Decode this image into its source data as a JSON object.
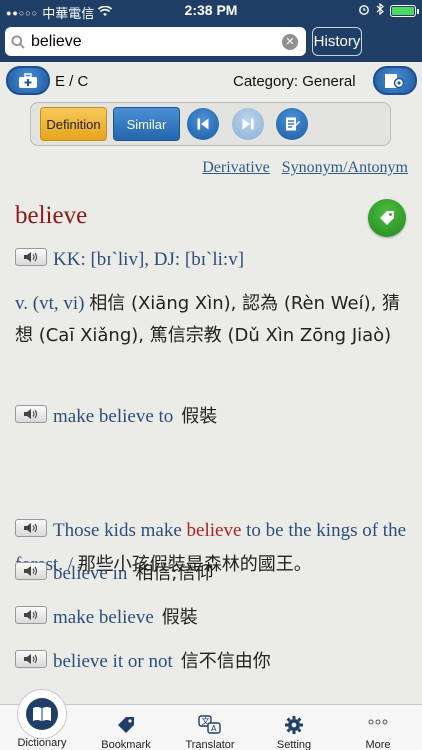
{
  "status": {
    "carrier": "中華電信",
    "time": "2:38 PM"
  },
  "search": {
    "value": "believe",
    "history_label": "History"
  },
  "header": {
    "mode": "E / C",
    "category": "Category: General"
  },
  "toolbar": {
    "definition_label": "Definition",
    "similar_label": "Similar"
  },
  "links": {
    "derivative": "Derivative",
    "synonym": "Synonym/Antonym"
  },
  "entry": {
    "headword": "believe",
    "pronunciation": "KK: [bɪˋliv], DJ: [bɪˋli:v]",
    "pos": "v. (vt, vi)",
    "definition_zh": "相信 (Xiāng Xìn), 認為 (Rèn Weí), 猜想 (Caī Xiǎng), 篤信宗教 (Dǔ Xìn Zōng Jiaò)",
    "phrases": [
      {
        "en": "make believe to",
        "zh": "假裝"
      },
      {
        "en": "believe in",
        "zh": "相信;信仰"
      },
      {
        "en": "make believe",
        "zh": "假裝"
      },
      {
        "en": "believe it or not",
        "zh": "信不信由你"
      }
    ],
    "example": {
      "before": "Those kids make ",
      "highlight": "believe",
      "after": " to be the kings of the forest. / ",
      "zh": "那些小孩假裝是森林的國王。"
    }
  },
  "tabs": {
    "dictionary": "Dictionary",
    "bookmark": "Bookmark",
    "translator": "Translator",
    "setting": "Setting",
    "more": "More"
  },
  "colors": {
    "navbar": "#1f3f66",
    "headword": "#8b1a1a",
    "body_text": "#2b4f7a",
    "accent_orange": "#e6a51f",
    "accent_blue": "#2566ad",
    "tag_green": "#1e8a1e"
  }
}
